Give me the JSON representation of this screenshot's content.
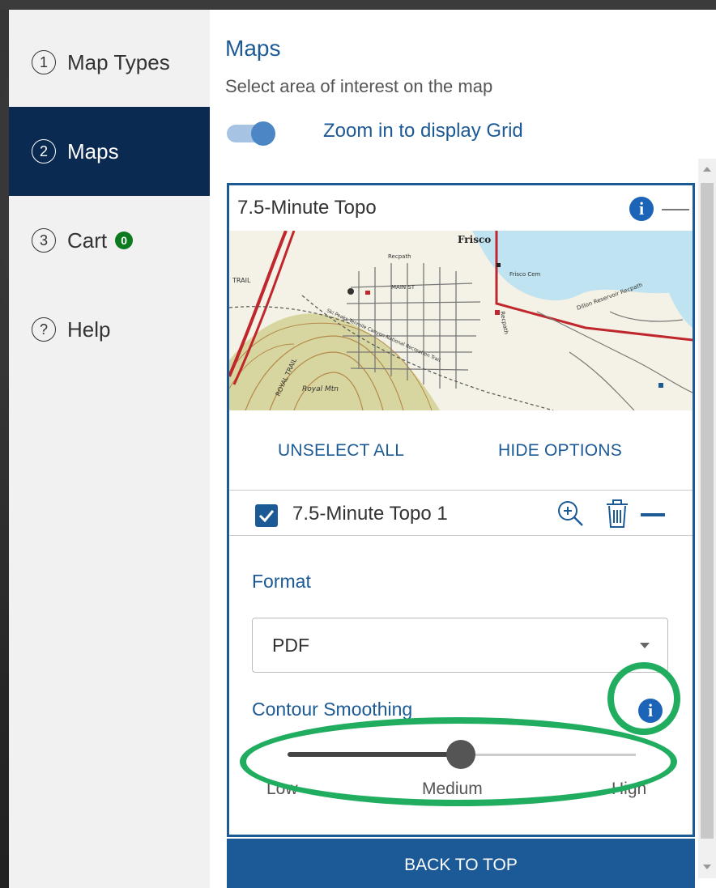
{
  "sidebar": {
    "items": [
      {
        "number": "1",
        "label": "Map Types"
      },
      {
        "number": "2",
        "label": "Maps"
      },
      {
        "number": "3",
        "label": "Cart",
        "badge": "0"
      },
      {
        "number": "?",
        "label": "Help"
      }
    ],
    "active_index": 1
  },
  "main": {
    "title": "Maps",
    "subtitle": "Select area of interest on the map",
    "grid_toggle": {
      "label": "Zoom in to display Grid",
      "on": true
    }
  },
  "card": {
    "title": "7.5-Minute Topo",
    "map_labels": {
      "frisco": "Frisco",
      "royal_mtn": "Royal Mtn",
      "trail": "TRAIL",
      "royal_trail": "ROYAL TRAIL",
      "frisco_cem": "Frisco Cem",
      "recpath1": "Recpath",
      "recpath2": "Recpath",
      "dillon": "Dillon Reservoir Recpath",
      "main_st": "MAIN ST",
      "national_rec": "Ski Peaks Tenmile Canyon National Recreation Trail"
    },
    "unselect_all": "UNSELECT ALL",
    "hide_options": "HIDE OPTIONS",
    "item": {
      "label": "7.5-Minute Topo 1",
      "checked": true
    },
    "format": {
      "label": "Format",
      "value": "PDF"
    },
    "contour_smoothing": {
      "label": "Contour Smoothing",
      "ticks": [
        "Low",
        "Medium",
        "High"
      ],
      "value": "Medium"
    }
  },
  "back_to_top": "BACK TO TOP",
  "colors": {
    "nav_active": "#0b2a52",
    "accent_blue": "#1c5a96",
    "badge_green": "#0c7a1f",
    "annotation_green": "#21ad5f"
  }
}
